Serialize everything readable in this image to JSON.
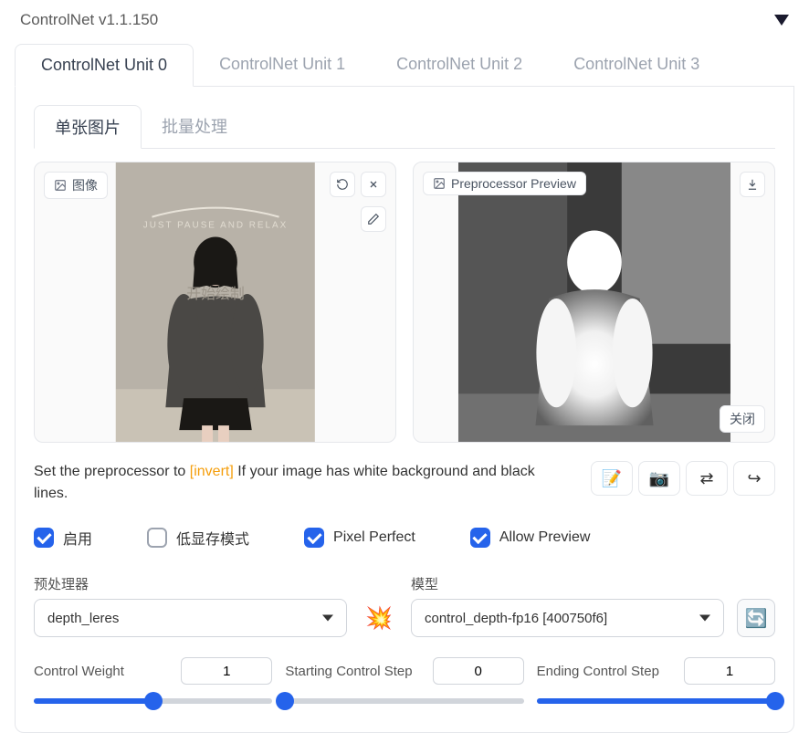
{
  "header": {
    "title": "ControlNet v1.1.150"
  },
  "tabs_outer": [
    "ControlNet Unit 0",
    "ControlNet Unit 1",
    "ControlNet Unit 2",
    "ControlNet Unit 3"
  ],
  "tabs_inner": [
    "单张图片",
    "批量处理"
  ],
  "panels": {
    "input": {
      "label": "图像",
      "overlay_text": "开始绘制"
    },
    "preview": {
      "label": "Preprocessor Preview",
      "close_label": "关闭"
    }
  },
  "help": {
    "prefix": "Set the preprocessor to ",
    "link": "[invert]",
    "suffix": " If your image has white background and black lines."
  },
  "checks": {
    "enable": {
      "label": "启用",
      "checked": true
    },
    "lowvram": {
      "label": "低显存模式",
      "checked": false
    },
    "pixel_perfect": {
      "label": "Pixel Perfect",
      "checked": true
    },
    "allow_preview": {
      "label": "Allow Preview",
      "checked": true
    }
  },
  "preprocessor": {
    "label": "预处理器",
    "value": "depth_leres"
  },
  "model": {
    "label": "模型",
    "value": "control_depth-fp16 [400750f6]"
  },
  "sliders": {
    "weight": {
      "label": "Control Weight",
      "value": "1",
      "fill_pct": 50
    },
    "start": {
      "label": "Starting Control Step",
      "value": "0",
      "fill_pct": 0
    },
    "end": {
      "label": "Ending Control Step",
      "value": "1",
      "fill_pct": 100
    }
  },
  "icons": {
    "image": "image-icon",
    "undo": "undo-icon",
    "close": "close-icon",
    "pencil": "pencil-icon",
    "download": "download-icon",
    "doc_new": "📝",
    "camera": "📷",
    "swap": "⇄",
    "send": "↪",
    "burst": "💥",
    "refresh": "🔄"
  }
}
